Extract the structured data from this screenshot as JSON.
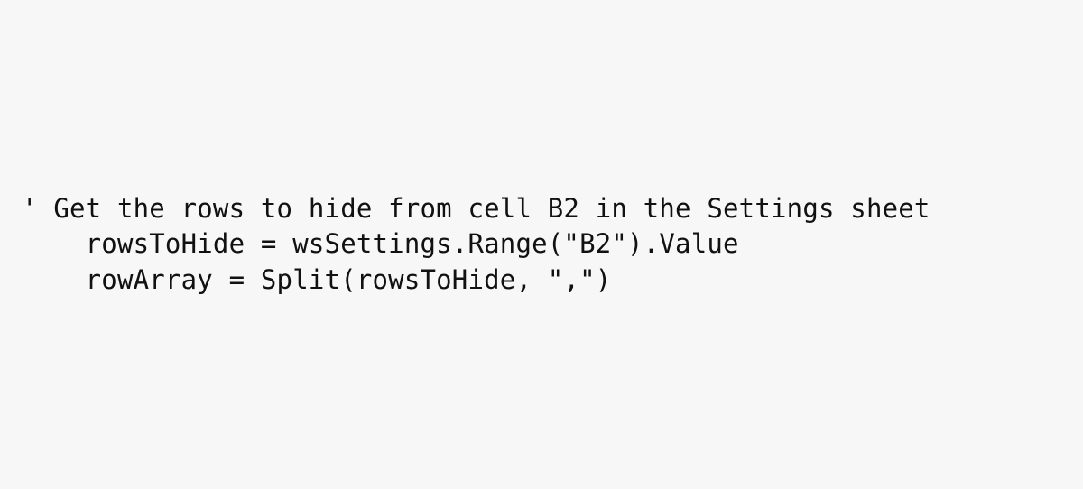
{
  "code": {
    "language": "vba",
    "lines": [
      "' Get the rows to hide from cell B2 in the Settings sheet",
      "    rowsToHide = wsSettings.Range(\"B2\").Value",
      "    rowArray = Split(rowsToHide, \",\")"
    ]
  }
}
